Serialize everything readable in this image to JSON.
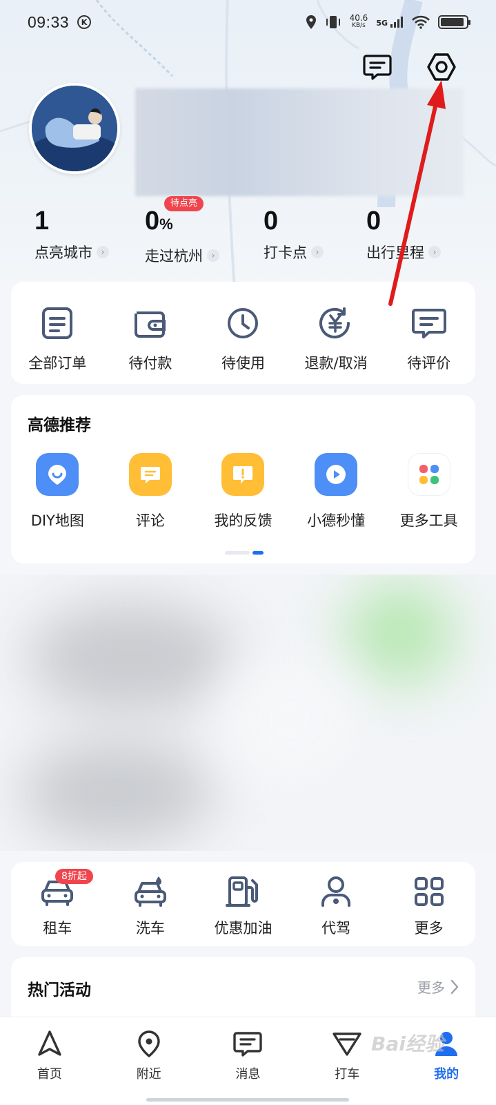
{
  "status_bar": {
    "time": "09:33",
    "k_indicator": "K",
    "net_speed_value": "40.6",
    "net_speed_unit": "KB/s",
    "network": "5G",
    "battery_level": 0.92
  },
  "header": {
    "message_icon": "message-icon",
    "settings_icon": "settings-icon"
  },
  "stats": [
    {
      "value": "1",
      "label": "点亮城市"
    },
    {
      "value": "0",
      "suffix": "%",
      "label": "走过杭州",
      "badge": "待点亮"
    },
    {
      "value": "0",
      "label": "打卡点"
    },
    {
      "value": "0",
      "label": "出行里程"
    }
  ],
  "orders": [
    {
      "label": "全部订单",
      "icon": "order-list-icon"
    },
    {
      "label": "待付款",
      "icon": "wallet-icon"
    },
    {
      "label": "待使用",
      "icon": "clock-icon"
    },
    {
      "label": "退款/取消",
      "icon": "refund-icon"
    },
    {
      "label": "待评价",
      "icon": "comment-icon"
    }
  ],
  "recommend": {
    "title": "高德推荐",
    "items": [
      {
        "label": "DIY地图",
        "icon": "diy-map-icon",
        "color": "#4d8ef7"
      },
      {
        "label": "评论",
        "icon": "review-icon",
        "color": "#ffbe35"
      },
      {
        "label": "我的反馈",
        "icon": "feedback-icon",
        "color": "#ffbe35"
      },
      {
        "label": "小德秒懂",
        "icon": "play-icon",
        "color": "#4d8ef7"
      },
      {
        "label": "更多工具",
        "icon": "more-tools-icon",
        "color": "#ffffff"
      }
    ]
  },
  "services": [
    {
      "label": "租车",
      "icon": "rent-car-icon",
      "badge": "8折起"
    },
    {
      "label": "洗车",
      "icon": "car-wash-icon"
    },
    {
      "label": "优惠加油",
      "icon": "fuel-icon"
    },
    {
      "label": "代驾",
      "icon": "driver-icon"
    },
    {
      "label": "更多",
      "icon": "grid-icon"
    }
  ],
  "events": {
    "title": "热门活动",
    "more": "更多"
  },
  "bottom_nav": [
    {
      "label": "首页",
      "icon": "navigate-icon"
    },
    {
      "label": "附近",
      "icon": "location-pin-icon"
    },
    {
      "label": "消息",
      "icon": "message-icon"
    },
    {
      "label": "打车",
      "icon": "taxi-icon"
    },
    {
      "label": "我的",
      "icon": "user-icon",
      "active": true
    }
  ],
  "watermark": "Bai经验",
  "accent_color": "#1f6ef0",
  "badge_color": "#f0454d"
}
